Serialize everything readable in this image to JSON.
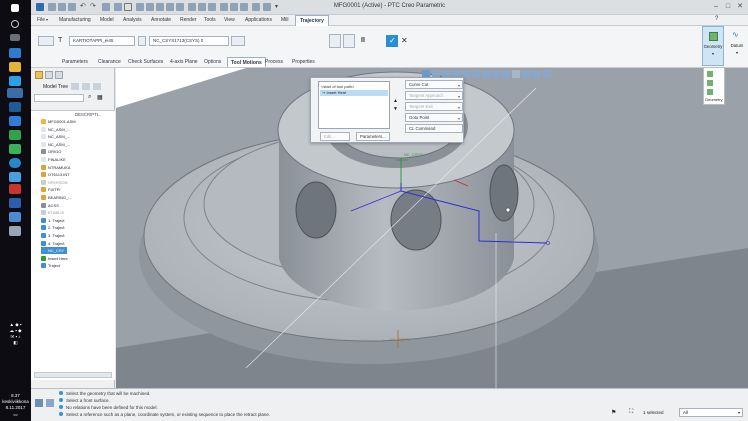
{
  "taskbar": {
    "time": "8.37",
    "day": "keskiviikkona",
    "date": "8.11.2017"
  },
  "window": {
    "title": "MFG0001 (Active) - PTC Creo Parametric"
  },
  "menubar": {
    "file": "File",
    "tabs": [
      "Manufacturing",
      "Model",
      "Analysis",
      "Annotate",
      "Render",
      "Tools",
      "View",
      "Applications",
      "Mill",
      "Trajectory"
    ]
  },
  "ribbon": {
    "tool_name": "KARTIOTAPPI_ei45",
    "csys_name": "NC_CSYS1713(CSYS) 0",
    "tabs": [
      "Parameters",
      "Clearance",
      "Check Surfaces",
      "4-axis Plane",
      "Options",
      "Tool Motions",
      "Process",
      "Properties"
    ],
    "active_tab": "Tool Motions",
    "pause_label": "II",
    "geometry_label": "Geometry",
    "datum_label": "Datum"
  },
  "model_tree": {
    "title": "Model Tree",
    "column_header": "DESCRIPTI...",
    "items": [
      {
        "label": "MFG0001.ASM",
        "kind": "asm"
      },
      {
        "label": "NC_ASM_...",
        "kind": "plane"
      },
      {
        "label": "NC_ASM_...",
        "kind": "plane"
      },
      {
        "label": "NC_ASM_...",
        "kind": "plane"
      },
      {
        "label": "ORIGO",
        "kind": "csys"
      },
      {
        "label": "FINALIKE",
        "kind": "plane"
      },
      {
        "label": "NTRAMUKA",
        "kind": "part"
      },
      {
        "label": "OT6113.INT",
        "kind": "part"
      },
      {
        "label": "SPERSON",
        "kind": "dim"
      },
      {
        "label": "FIXTPI",
        "kind": "part"
      },
      {
        "label": "BEARING_...",
        "kind": "part"
      },
      {
        "label": "ACSS",
        "kind": "csys"
      },
      {
        "label": "ETABLIS",
        "kind": "dim"
      },
      {
        "label": "1. Traject",
        "kind": "traj"
      },
      {
        "label": "2. Traject",
        "kind": "traj"
      },
      {
        "label": "3. Traject",
        "kind": "traj"
      },
      {
        "label": "4. Traject",
        "kind": "traj"
      },
      {
        "label": "NC_CSY",
        "kind": "sel"
      },
      {
        "label": "Insert Here",
        "kind": "insert"
      },
      {
        "label": "Traject",
        "kind": "traj"
      }
    ]
  },
  "dialog": {
    "list_header": "<start of tool path>",
    "list_item": "Insert Here",
    "edit_label": "Edit...",
    "parameters_label": "Parameters...",
    "options": [
      {
        "label": "Curve Cut",
        "enabled": true
      },
      {
        "label": "Tangent Approach",
        "enabled": false
      },
      {
        "label": "Tangent Exit",
        "enabled": false
      },
      {
        "label": "Goto Point",
        "enabled": true
      },
      {
        "label": "CL Command",
        "enabled": true
      }
    ]
  },
  "scene": {
    "label_top": "NC_CSYS",
    "label_bottom": "NC_CSYS"
  },
  "status": {
    "messages": [
      "Select the geometry that will be machined.",
      "Select a front surface.",
      "No relations have been defined for this model.",
      "Select a reference such as a plane, coordinate system, or existing sequence to place the retract plane."
    ],
    "selected": "1 selected",
    "filter": "All"
  },
  "colors": {
    "accent_blue": "#3f8fd6",
    "csys_green": "#2e9a3c",
    "path_blue": "#2c2cd8",
    "axis_red": "#c82d2d",
    "part_gray": "#a6adb4"
  }
}
